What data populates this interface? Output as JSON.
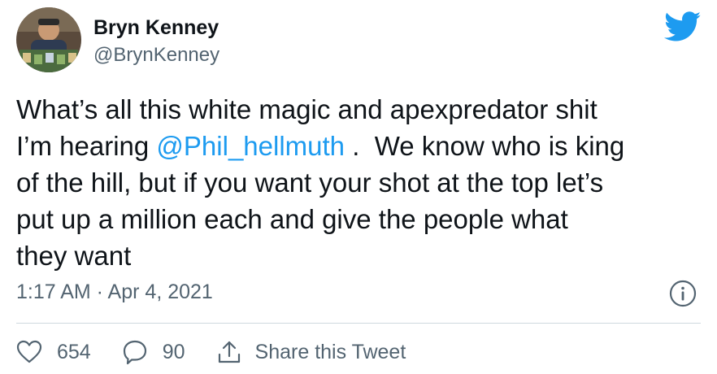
{
  "author": {
    "display_name": "Bryn Kenney",
    "handle": "@BrynKenney"
  },
  "tweet": {
    "text_before_mention": "What’s all this white magic and apexpredator shit\nI’m hearing ",
    "mention": "@Phil_hellmuth",
    "text_after_mention": " .  We know who is king\nof the hill, but if you want your shot at the top let’s\nput up a million each and give the people what\nthey want"
  },
  "meta": {
    "time": "1:17 AM · Apr 4, 2021"
  },
  "actions": {
    "likes": "654",
    "replies": "90",
    "share_label": "Share this Tweet"
  },
  "colors": {
    "accent": "#1d9bf0",
    "text_primary": "#0f1419",
    "text_secondary": "#536471",
    "divider": "#cfd9de"
  },
  "icons": {
    "brand": "twitter-bird-icon",
    "info": "info-icon",
    "like": "heart-icon",
    "reply": "reply-icon",
    "share": "share-icon"
  }
}
